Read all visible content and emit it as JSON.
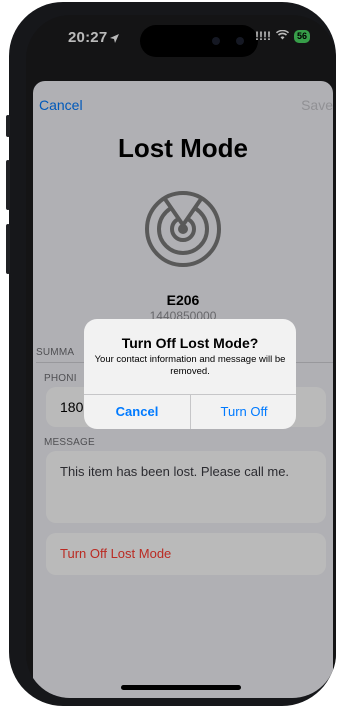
{
  "status_bar": {
    "time": "20:27",
    "location_icon": "location-arrow-icon",
    "signal": "!!!!",
    "wifi_icon": "wifi-icon",
    "battery": "56"
  },
  "sheet": {
    "nav": {
      "cancel": "Cancel",
      "save": "Save"
    },
    "title": "Lost Mode",
    "device_icon": "radar-target-icon",
    "device_name": "E206",
    "device_serial": "1440850000",
    "summary_label": "SUMMA",
    "phone_label": "PHONI",
    "phone_value": "180",
    "message_label": "MESSAGE",
    "message_value": "This item has been lost. Please call me.",
    "turn_off_lost_mode": "Turn Off Lost Mode"
  },
  "alert": {
    "title": "Turn Off Lost Mode?",
    "message": "Your contact information and message will be removed.",
    "cancel": "Cancel",
    "turn_off": "Turn Off"
  },
  "colors": {
    "accent": "#007aff",
    "destructive": "#ff3b30",
    "disabled": "#c7c7cc",
    "battery": "#4cd964"
  }
}
